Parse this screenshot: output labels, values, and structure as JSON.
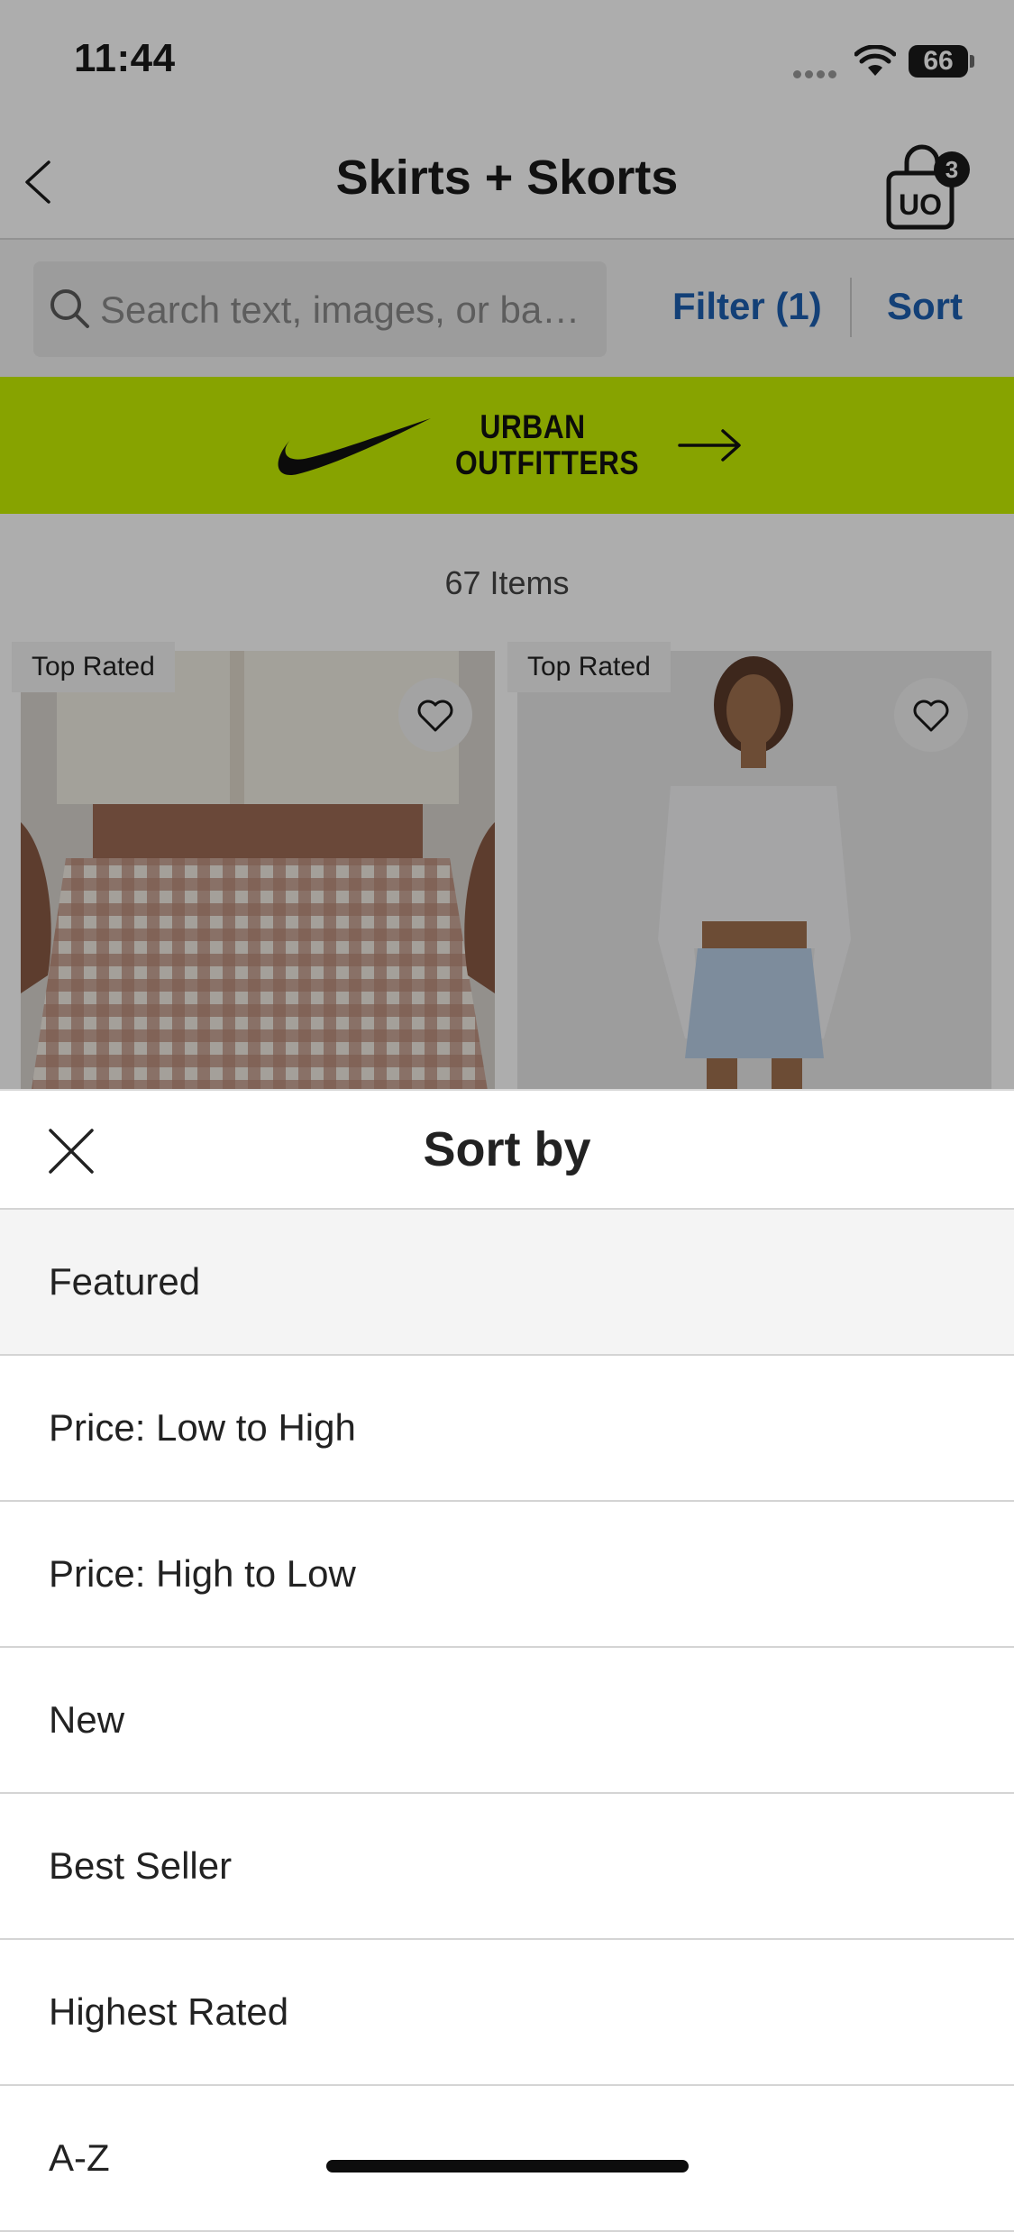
{
  "status_bar": {
    "time": "11:44",
    "battery": "66"
  },
  "nav": {
    "title": "Skirts + Skorts",
    "cart_count": "3",
    "cart_logo_text": "UO"
  },
  "search": {
    "placeholder": "Search text, images, or ba…"
  },
  "toolbar": {
    "filter_label": "Filter (1)",
    "sort_label": "Sort"
  },
  "promo": {
    "brand_line1": "URBAN",
    "brand_line2": "OUTFITTERS",
    "background_color": "#c8f000"
  },
  "listing": {
    "item_count": "67 Items",
    "products": [
      {
        "badge": "Top Rated"
      },
      {
        "badge": "Top Rated"
      }
    ]
  },
  "sort_sheet": {
    "title": "Sort by",
    "options": [
      {
        "label": "Featured",
        "selected": true
      },
      {
        "label": "Price: Low to High",
        "selected": false
      },
      {
        "label": "Price: High to Low",
        "selected": false
      },
      {
        "label": "New",
        "selected": false
      },
      {
        "label": "Best Seller",
        "selected": false
      },
      {
        "label": "Highest Rated",
        "selected": false
      },
      {
        "label": "A-Z",
        "selected": false
      }
    ]
  },
  "colors": {
    "link_blue": "#1d5fb0",
    "promo_green": "#c8f000",
    "selected_row": "#f4f4f4"
  }
}
